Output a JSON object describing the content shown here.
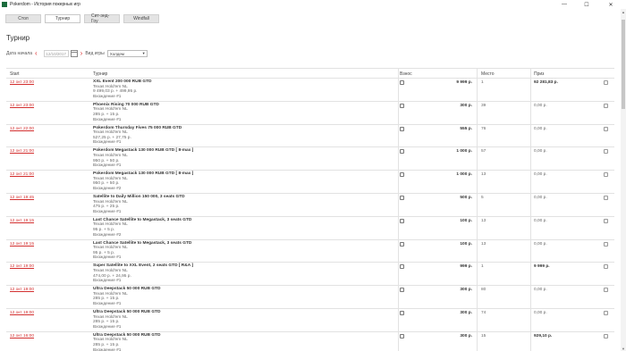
{
  "window": {
    "title": "Pokerdom - История покерных игр",
    "controls": {
      "minimize": "—",
      "maximize": "☐",
      "close": "✕"
    }
  },
  "tabs": [
    {
      "label": "Стол"
    },
    {
      "label": "Турнир"
    },
    {
      "label": "Сит-энд-Гоу"
    },
    {
      "label": "Windfall"
    }
  ],
  "active_tab": "Турнир",
  "page_title": "Турнир",
  "filters": {
    "date_label": "Дата начала",
    "date_value": "12/10/2017",
    "game_type_label": "Вид игры",
    "game_type_value": "Холдем"
  },
  "columns": {
    "start": "Start",
    "tournament": "Турнир",
    "buyin": "Взнос",
    "place": "Место",
    "prize": "Приз"
  },
  "rows": [
    {
      "start": "12 окт 23:00",
      "name": "XXL Event 200 000 RUB GTD",
      "game": "Texas Hold'em NL",
      "fee": "9 499,03 р. + 499,95 р.",
      "entry": "Вхождение #1",
      "buyin": "9 999 р.",
      "place": "1",
      "prize": "92 281,83 р.",
      "prize_bold": true
    },
    {
      "start": "12 окт 23:00",
      "name": "Phoenix Rising 70 000 RUB GTD",
      "game": "Texas Hold'em NL",
      "fee": "285 р. + 15 р.",
      "entry": "Вхождение #1",
      "buyin": "300 р.",
      "place": "39",
      "prize": "0,00 р.",
      "prize_bold": false
    },
    {
      "start": "12 окт 22:00",
      "name": "Pokerdom Thursday Fives 75 000 RUB GTD",
      "game": "Texas Hold'em NL",
      "fee": "527,25 р. + 27,75 р.",
      "entry": "Вхождение #1",
      "buyin": "555 р.",
      "place": "76",
      "prize": "0,00 р.",
      "prize_bold": false
    },
    {
      "start": "12 окт 21:00",
      "name": "Pokerdom Megastack 130 000 RUB GTD [ 8-max ]",
      "game": "Texas Hold'em NL",
      "fee": "950 р. + 50 р.",
      "entry": "Вхождение #1",
      "buyin": "1 000 р.",
      "place": "57",
      "prize": "0,00 р.",
      "prize_bold": false
    },
    {
      "start": "12 окт 21:00",
      "name": "Pokerdom Megastack 130 000 RUB GTD [ 8-max ]",
      "game": "Texas Hold'em NL",
      "fee": "950 р. + 50 р.",
      "entry": "Вхождение #2",
      "buyin": "1 000 р.",
      "place": "13",
      "prize": "0,00 р.",
      "prize_bold": false
    },
    {
      "start": "12 окт 19:45",
      "name": "Satellite to Daily Million 150 000, 3 seats GTD",
      "game": "Texas Hold'em NL",
      "fee": "475 р. + 25 р.",
      "entry": "Вхождение #1",
      "buyin": "500 р.",
      "place": "5",
      "prize": "0,00 р.",
      "prize_bold": false
    },
    {
      "start": "12 окт 19:15",
      "name": "Last Chance Satellite to Megastack, 3 seats GTD",
      "game": "Texas Hold'em NL",
      "fee": "95 р. + 5 р.",
      "entry": "Вхождение #2",
      "buyin": "100 р.",
      "place": "13",
      "prize": "0,00 р.",
      "prize_bold": false
    },
    {
      "start": "12 окт 19:15",
      "name": "Last Chance Satellite to Megastack, 3 seats GTD",
      "game": "Texas Hold'em NL",
      "fee": "95 р. + 5 р.",
      "entry": "Вхождение #1",
      "buyin": "100 р.",
      "place": "13",
      "prize": "0,00 р.",
      "prize_bold": false
    },
    {
      "start": "12 окт 19:00",
      "name": "Super Satellite to XXL Event, 2 seats GTD [ R&A ]",
      "game": "Texas Hold'em NL",
      "fee": "474,00 р. + 24,95 р.",
      "entry": "Вхождение #1",
      "buyin": "999 р.",
      "place": "1",
      "prize": "9 999 р.",
      "prize_bold": true
    },
    {
      "start": "12 окт 19:00",
      "name": "Ultra Deepstack 50 000 RUB GTD",
      "game": "Texas Hold'em NL",
      "fee": "285 р. + 15 р.",
      "entry": "Вхождение #1",
      "buyin": "300 р.",
      "place": "80",
      "prize": "0,00 р.",
      "prize_bold": false
    },
    {
      "start": "12 окт 19:00",
      "name": "Ultra Deepstack 50 000 RUB GTD",
      "game": "Texas Hold'em NL",
      "fee": "285 р. + 15 р.",
      "entry": "Вхождение #1",
      "buyin": "300 р.",
      "place": "74",
      "prize": "0,00 р.",
      "prize_bold": false
    },
    {
      "start": "12 окт 16:00",
      "name": "Ultra Deepstack 50 000 RUB GTD",
      "game": "Texas Hold'em NL",
      "fee": "285 р. + 15 р.",
      "entry": "Вхождение #1",
      "buyin": "300 р.",
      "place": "15",
      "prize": "929,10 р.",
      "prize_bold": true
    }
  ]
}
